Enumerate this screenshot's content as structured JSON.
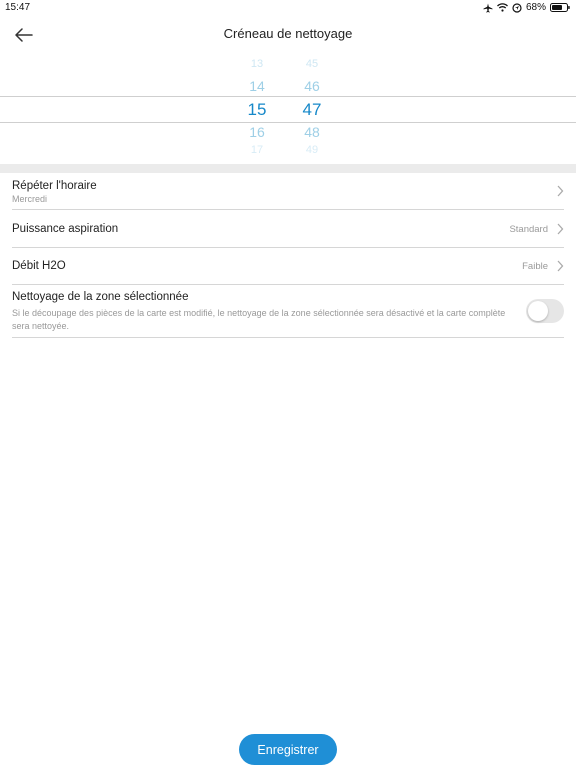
{
  "status_bar": {
    "time": "15:47",
    "battery": "68%",
    "icons": [
      "airplane-icon",
      "wifi-icon",
      "location-icon",
      "battery-icon"
    ]
  },
  "header": {
    "title": "Créneau de nettoyage",
    "back_icon": "arrow-left-icon"
  },
  "time_picker": {
    "hours": [
      "13",
      "14",
      "15",
      "16",
      "17"
    ],
    "minutes": [
      "45",
      "46",
      "47",
      "48",
      "49"
    ],
    "selected_hour": "15",
    "selected_minute": "47",
    "selected_color": "#1688c9"
  },
  "settings": {
    "repeat": {
      "title": "Répéter l'horaire",
      "subtitle": "Mercredi"
    },
    "suction": {
      "title": "Puissance aspiration",
      "value": "Standard"
    },
    "water": {
      "title": "Débit H2O",
      "value": "Faible"
    },
    "zone": {
      "title": "Nettoyage de la zone sélectionnée",
      "description": "Si le découpage des pièces de la carte est modifié, le nettoyage de la zone sélectionnée sera désactivé et la carte complète sera nettoyée.",
      "enabled": false
    }
  },
  "footer": {
    "save_label": "Enregistrer",
    "accent_color": "#1f8fd6"
  }
}
